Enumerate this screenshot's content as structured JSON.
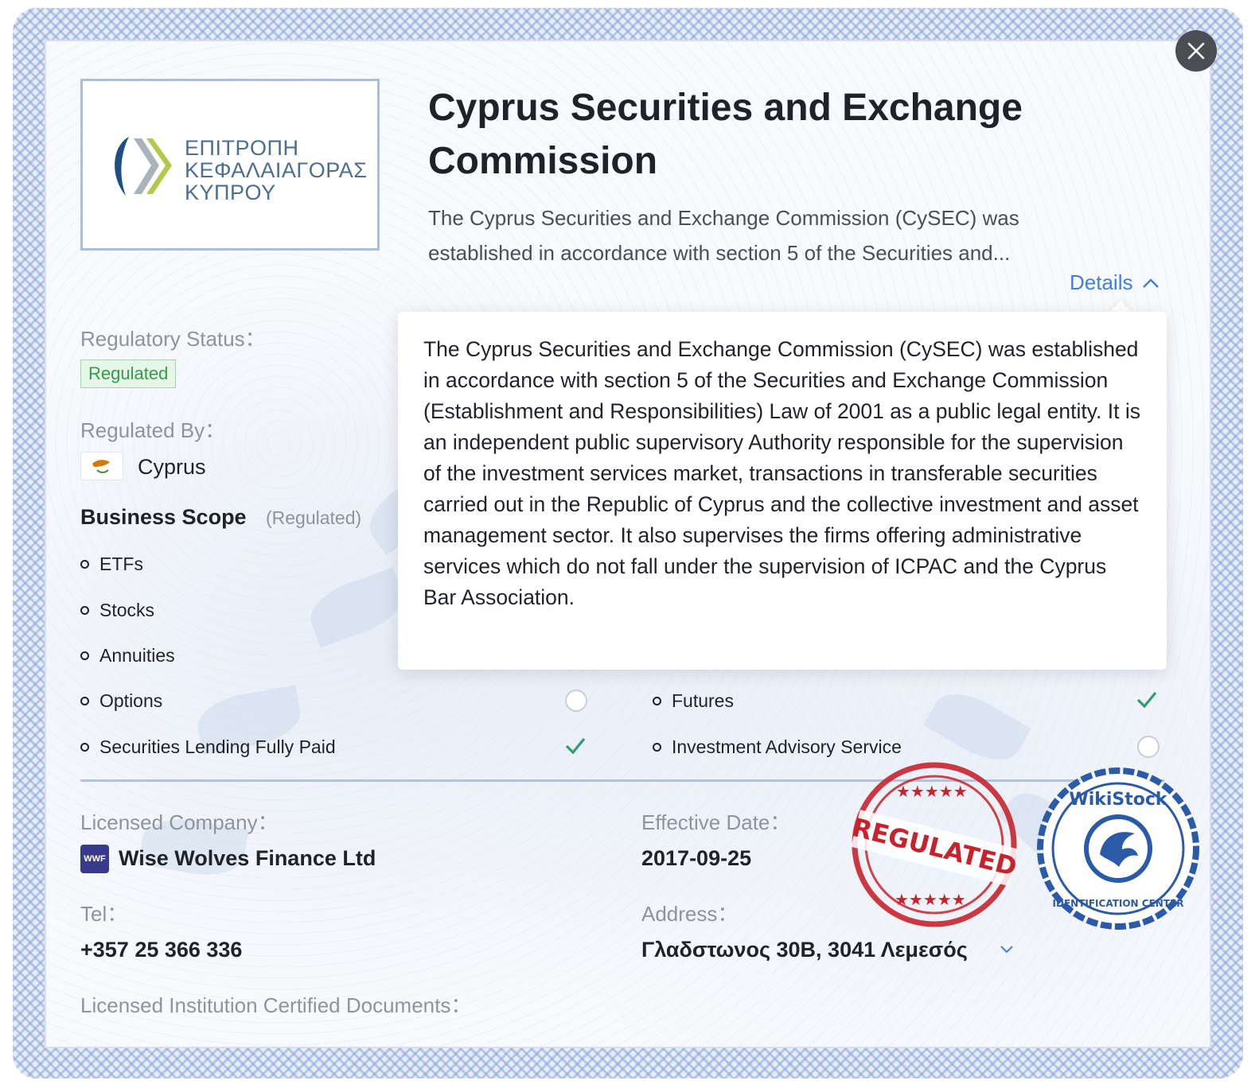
{
  "header": {
    "title": "Cyprus Securities and Exchange Commission",
    "summary": "The Cyprus Securities and Exchange Commission (CySEC) was established in accordance with section 5 of the Securities and...",
    "details_label": "Details"
  },
  "logo": {
    "lines": [
      "ΕΠΙΤΡΟΠΗ",
      "ΚΕΦΑΛΑΙΑΓΟΡΑΣ",
      "ΚΥΠΡΟΥ"
    ]
  },
  "popover": {
    "text": "The Cyprus Securities and Exchange Commission (CySEC) was established in accordance with section 5 of the Securities and Exchange Commission (Establishment and Responsibilities) Law of 2001 as a public legal entity. It is an independent public supervisory Authority responsible for the supervision of the investment services market, transactions in transferable securities carried out in the Republic of Cyprus and the collective investment and asset management sector. It also supervises the firms offering administrative services which do not fall under the supervision of ICPAC and the Cyprus Bar Association."
  },
  "regulatory": {
    "status_label": "Regulatory Status：",
    "status_value": "Regulated",
    "by_label": "Regulated By：",
    "by_value": "Cyprus"
  },
  "business_scope": {
    "title": "Business Scope",
    "subtitle": "(Regulated)",
    "items": [
      {
        "label": "ETFs"
      },
      {
        "label": "Stocks"
      },
      {
        "label": "Annuities"
      },
      {
        "label": "Options",
        "status": "not-included"
      },
      {
        "label": "Futures",
        "status": "included"
      },
      {
        "label": "Securities Lending Fully Paid",
        "status": "included"
      },
      {
        "label": "Investment Advisory Service",
        "status": "not-included"
      }
    ]
  },
  "license": {
    "company_label": "Licensed Company：",
    "company_value": "Wise Wolves Finance Ltd",
    "company_icon_text": "WWF",
    "date_label": "Effective Date：",
    "date_value": "2017-09-25",
    "tel_label": "Tel：",
    "tel_value": "+357 25 366 336",
    "address_label": "Address：",
    "address_value": "Γλαδστωνος 30Β, 3041 Λεμεσός",
    "docs_label": "Licensed Institution Certified Documents："
  },
  "stamps": {
    "regulated_text": "REGULATED",
    "wikistock_top": "WikiStock",
    "wikistock_bottom": "IDENTIFICATION CENTER"
  },
  "colors": {
    "accent": "#3f7fe0",
    "check": "#2f9e6f",
    "stamp_red": "#c8232c",
    "stamp_blue": "#2b5aa8"
  }
}
